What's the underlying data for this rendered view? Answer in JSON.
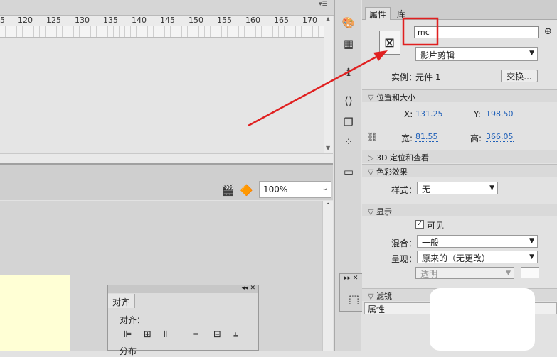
{
  "timeline": {
    "ruler_ticks": [
      "5",
      "120",
      "125",
      "130",
      "135",
      "140",
      "145",
      "150",
      "155",
      "160",
      "165",
      "170"
    ]
  },
  "stage": {
    "zoom": "100%"
  },
  "align_panel": {
    "tab": "对齐",
    "label": "对齐：",
    "partial_label": "分布"
  },
  "properties": {
    "tabs": [
      "属性",
      "库"
    ],
    "instance_name": "mc",
    "symbol_type": "影片剪辑",
    "instance_label": "实例：",
    "instance_value": "元件 1",
    "swap_button": "交换...",
    "sections": {
      "position_size": "位置和大小",
      "3d": "3D 定位和查看",
      "color_effect": "色彩效果",
      "display": "显示",
      "filters": "滤镜"
    },
    "x_label": "X:",
    "x_value": "131.25",
    "y_label": "Y:",
    "y_value": "198.50",
    "w_label": "宽:",
    "w_value": "81.55",
    "h_label": "高:",
    "h_value": "366.05",
    "style_label": "样式：",
    "style_value": "无",
    "visible_label": "可见",
    "blend_label": "混合：",
    "blend_value": "一般",
    "render_label": "呈现：",
    "render_value": "原来的（无更改）",
    "transparent_value": "透明",
    "filters_col": "属性"
  },
  "colors": {
    "accent": "#2060b8",
    "annotation": "#e02020"
  }
}
